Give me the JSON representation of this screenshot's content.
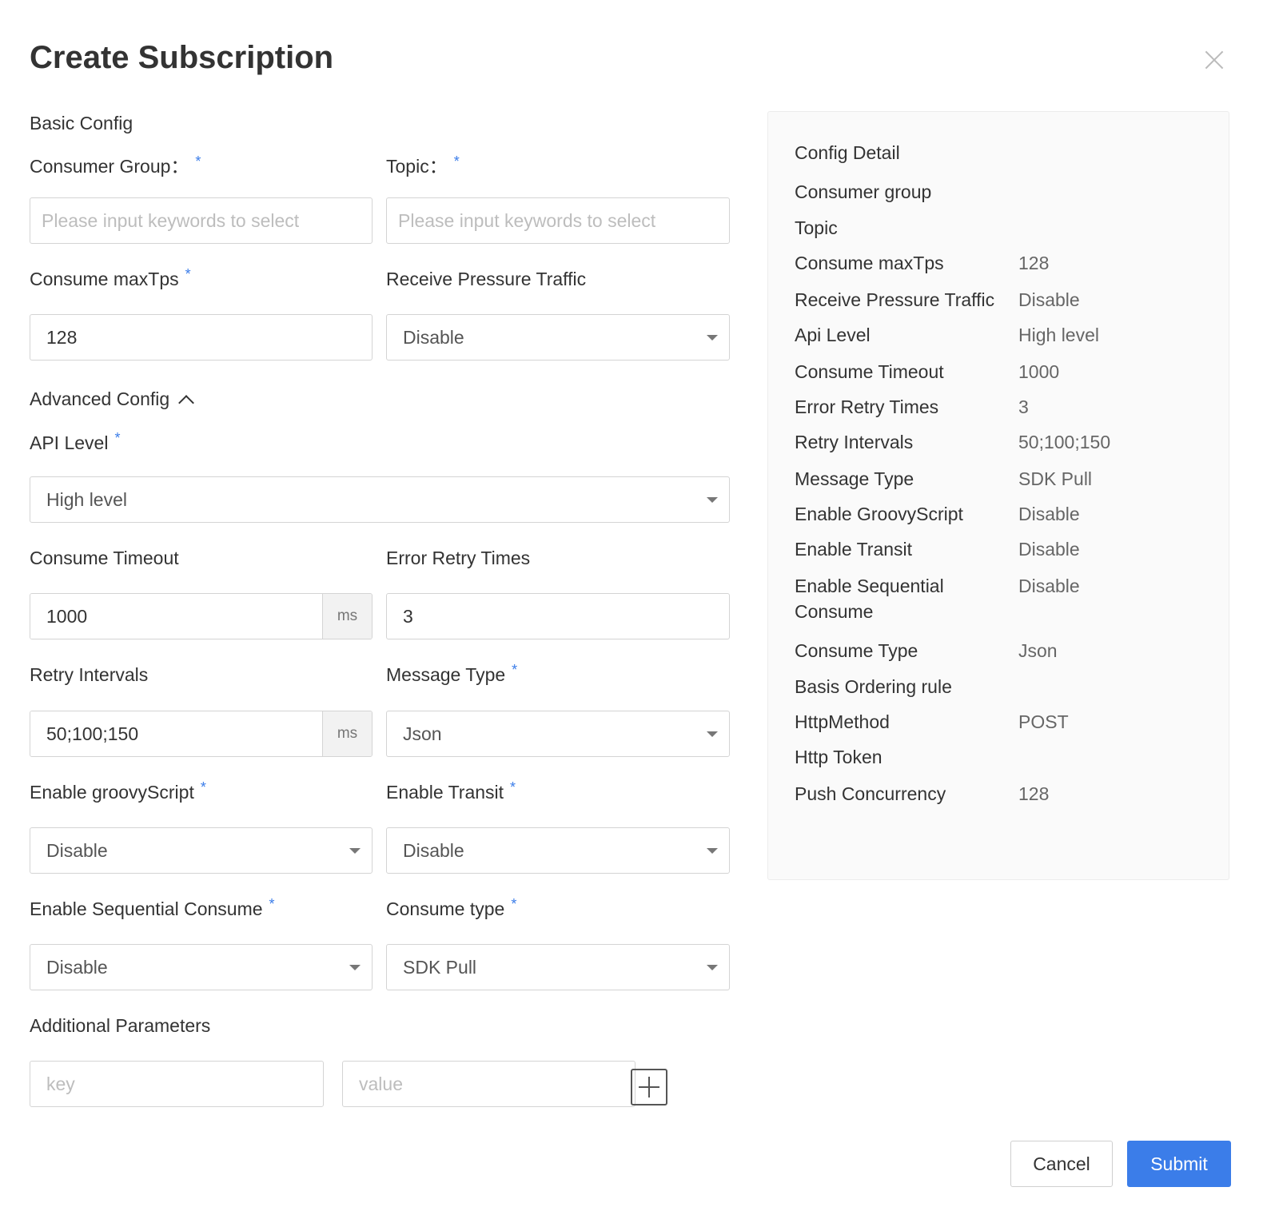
{
  "dialog": {
    "title": "Create Subscription"
  },
  "basic": {
    "section_label": "Basic Config",
    "consumer_group_label": "Consumer Group：",
    "consumer_group_placeholder": "Please input keywords to select",
    "topic_label": "Topic：",
    "topic_placeholder": "Please input keywords to select",
    "max_tps_label": "Consume maxTps",
    "max_tps_value": "128",
    "pressure_label": "Receive Pressure Traffic",
    "pressure_value": "Disable"
  },
  "advanced": {
    "section_label": "Advanced Config",
    "api_level_label": "API Level",
    "api_level_value": "High level",
    "timeout_label": "Consume Timeout",
    "timeout_value": "1000",
    "timeout_unit": "ms",
    "retry_times_label": "Error Retry Times",
    "retry_times_value": "3",
    "retry_intervals_label": "Retry Intervals",
    "retry_intervals_value": "50;100;150",
    "retry_intervals_unit": "ms",
    "message_type_label": "Message Type",
    "message_type_value": "Json",
    "groovy_label": "Enable groovyScript",
    "groovy_value": "Disable",
    "transit_label": "Enable Transit",
    "transit_value": "Disable",
    "sequential_label": "Enable Sequential Consume",
    "sequential_value": "Disable",
    "consume_type_label": "Consume type",
    "consume_type_value": "SDK Pull",
    "additional_label": "Additional Parameters",
    "key_placeholder": "key",
    "value_placeholder": "value"
  },
  "required_mark": "*",
  "detail": {
    "title": "Config Detail",
    "rows": [
      {
        "key": "Consumer group",
        "value": ""
      },
      {
        "key": "Topic",
        "value": ""
      },
      {
        "key": "Consume maxTps",
        "value": "128"
      },
      {
        "key": "Receive Pressure Traffic",
        "value": "Disable"
      },
      {
        "key": "Api Level",
        "value": "High level"
      },
      {
        "key": "Consume Timeout",
        "value": "1000"
      },
      {
        "key": "Error Retry Times",
        "value": "3"
      },
      {
        "key": "Retry Intervals",
        "value": "50;100;150"
      },
      {
        "key": "Message Type",
        "value": "SDK Pull"
      },
      {
        "key": "Enable GroovyScript",
        "value": "Disable"
      },
      {
        "key": "Enable Transit",
        "value": "Disable"
      },
      {
        "key": "Enable Sequential Consume",
        "value": "Disable"
      },
      {
        "key": "Consume Type",
        "value": "Json"
      },
      {
        "key": "Basis Ordering rule",
        "value": ""
      },
      {
        "key": "HttpMethod",
        "value": "POST"
      },
      {
        "key": "Http Token",
        "value": ""
      },
      {
        "key": "Push Concurrency",
        "value": "128"
      }
    ]
  },
  "footer": {
    "cancel_label": "Cancel",
    "submit_label": "Submit"
  }
}
